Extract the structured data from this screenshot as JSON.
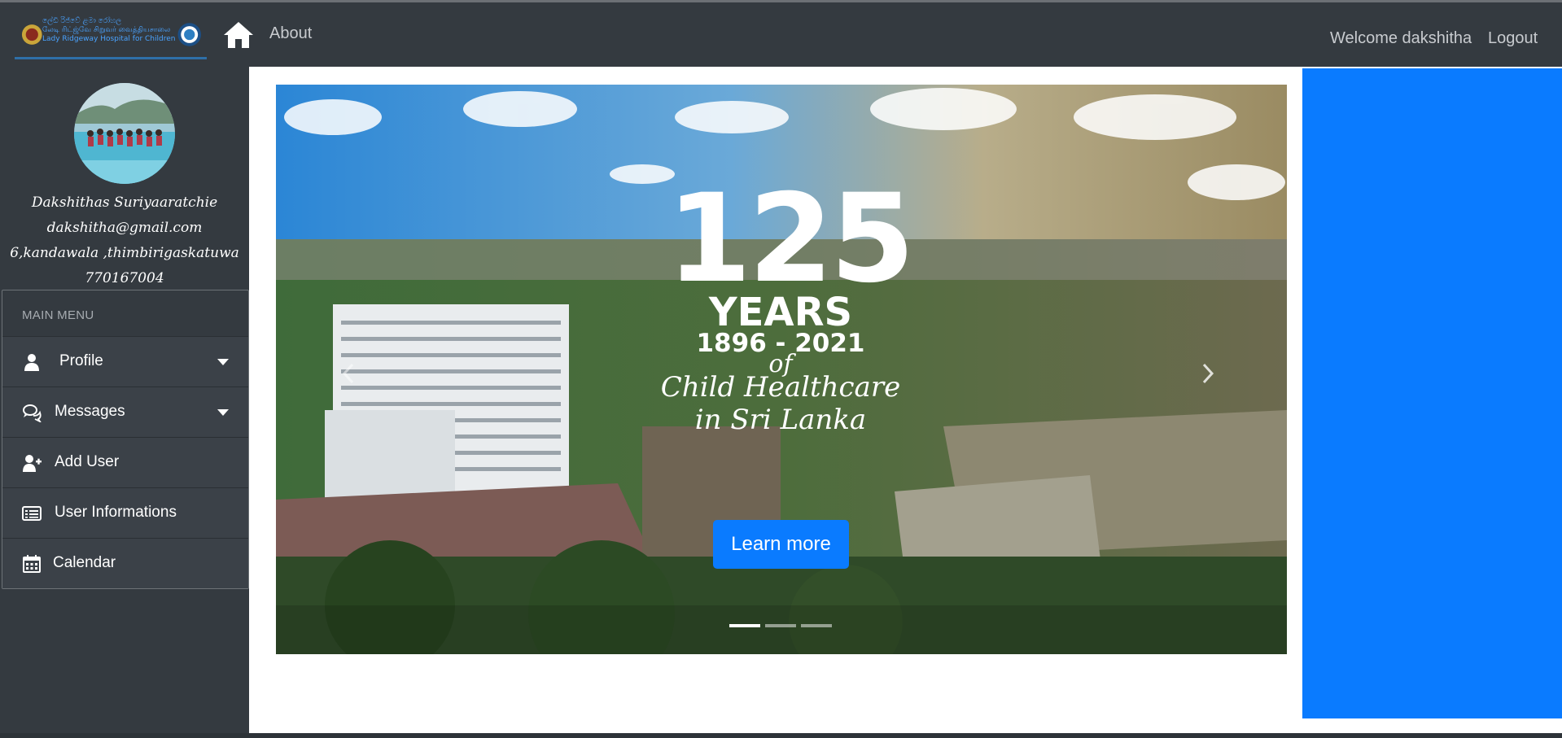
{
  "header": {
    "logo_text_line1": "ලේඩි රිජ්වේ ළමා රෝහල",
    "logo_text_line2": "லேடி ரிட்ஜ்வே சிறுவர் வைத்தியசாலை",
    "logo_text_line3": "Lady Ridgeway Hospital for Children",
    "about_label": "About",
    "welcome_text": "Welcome dakshitha",
    "logout_label": "Logout"
  },
  "profile": {
    "name": "Dakshithas Suriyaaratchie",
    "email": "dakshitha@gmail.com",
    "address": "6,kandawala ,thimbirigaskatuwa",
    "phone": "770167004"
  },
  "sidebar": {
    "menu_header": "MAIN MENU",
    "items": [
      {
        "label": "Profile",
        "icon": "user-icon",
        "has_dropdown": true
      },
      {
        "label": "Messages",
        "icon": "chat-icon",
        "has_dropdown": true
      },
      {
        "label": "Add User",
        "icon": "add-user-icon",
        "has_dropdown": false
      },
      {
        "label": "User Informations",
        "icon": "id-card-icon",
        "has_dropdown": false
      },
      {
        "label": "Calendar",
        "icon": "calendar-icon",
        "has_dropdown": false
      }
    ]
  },
  "carousel": {
    "headline_number": "125",
    "headline_years": "YEARS",
    "headline_dates": "1896 - 2021",
    "headline_of": "of",
    "headline_script_1": "Child Healthcare",
    "headline_script_2": "in Sri Lanka",
    "cta_label": "Learn more",
    "slide_count": 3,
    "active_slide": 1
  },
  "colors": {
    "topbar": "#343a40",
    "sidebar": "#343a40",
    "accent_blue": "#0a7bff",
    "text_light": "#c8cbcf"
  }
}
